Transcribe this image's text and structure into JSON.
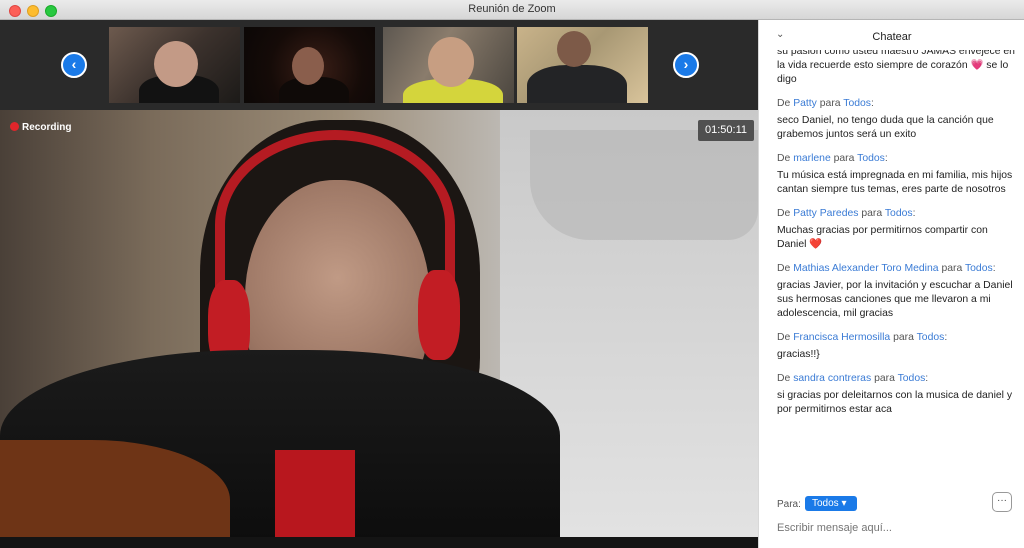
{
  "window": {
    "title": "Reunión de Zoom"
  },
  "video": {
    "nav_prev": "‹",
    "nav_next": "›",
    "recording_label": "Recording",
    "timer": "01:50:11",
    "accent": "#1a7ae8",
    "record_color": "#e0262b"
  },
  "chat": {
    "title": "Chatear",
    "first_message_tail": "su pasión como usted maestro JAMÁS envejece en la vida recuerde esto siempre de corazón 💗 se lo digo",
    "messages": [
      {
        "prefix": "De",
        "from": "Patty",
        "para": "para",
        "to": "Todos",
        "text": "seco Daniel, no tengo duda que la canción que grabemos juntos será un exito"
      },
      {
        "prefix": "De",
        "from": "marlene",
        "para": "para",
        "to": "Todos",
        "text": "Tu música está impregnada en mi familia, mis hijos cantan siempre tus temas, eres parte de nosotros"
      },
      {
        "prefix": "De",
        "from": "Patty Paredes",
        "para": "para",
        "to": "Todos",
        "text": "Muchas gracias por permitirnos compartir con Daniel ❤️"
      },
      {
        "prefix": "De",
        "from": "Mathias Alexander Toro Medina",
        "para": "para",
        "to": "Todos",
        "text": "gracias Javier, por la invitación y escuchar a Daniel sus hermosas canciones que me llevaron a mi adolescencia, mil gracias"
      },
      {
        "prefix": "De",
        "from": "Francisca Hermosilla",
        "para": "para",
        "to": "Todos",
        "text": "gracias!!}"
      },
      {
        "prefix": "De",
        "from": "sandra contreras",
        "para": "para",
        "to": "Todos",
        "text": "si gracias por deleitarnos con la musica de daniel y por permitirnos estar aca"
      }
    ],
    "to_label": "Para:",
    "to_value": "Todos",
    "more_label": "···",
    "compose_placeholder": "Escribir mensaje aquí..."
  }
}
